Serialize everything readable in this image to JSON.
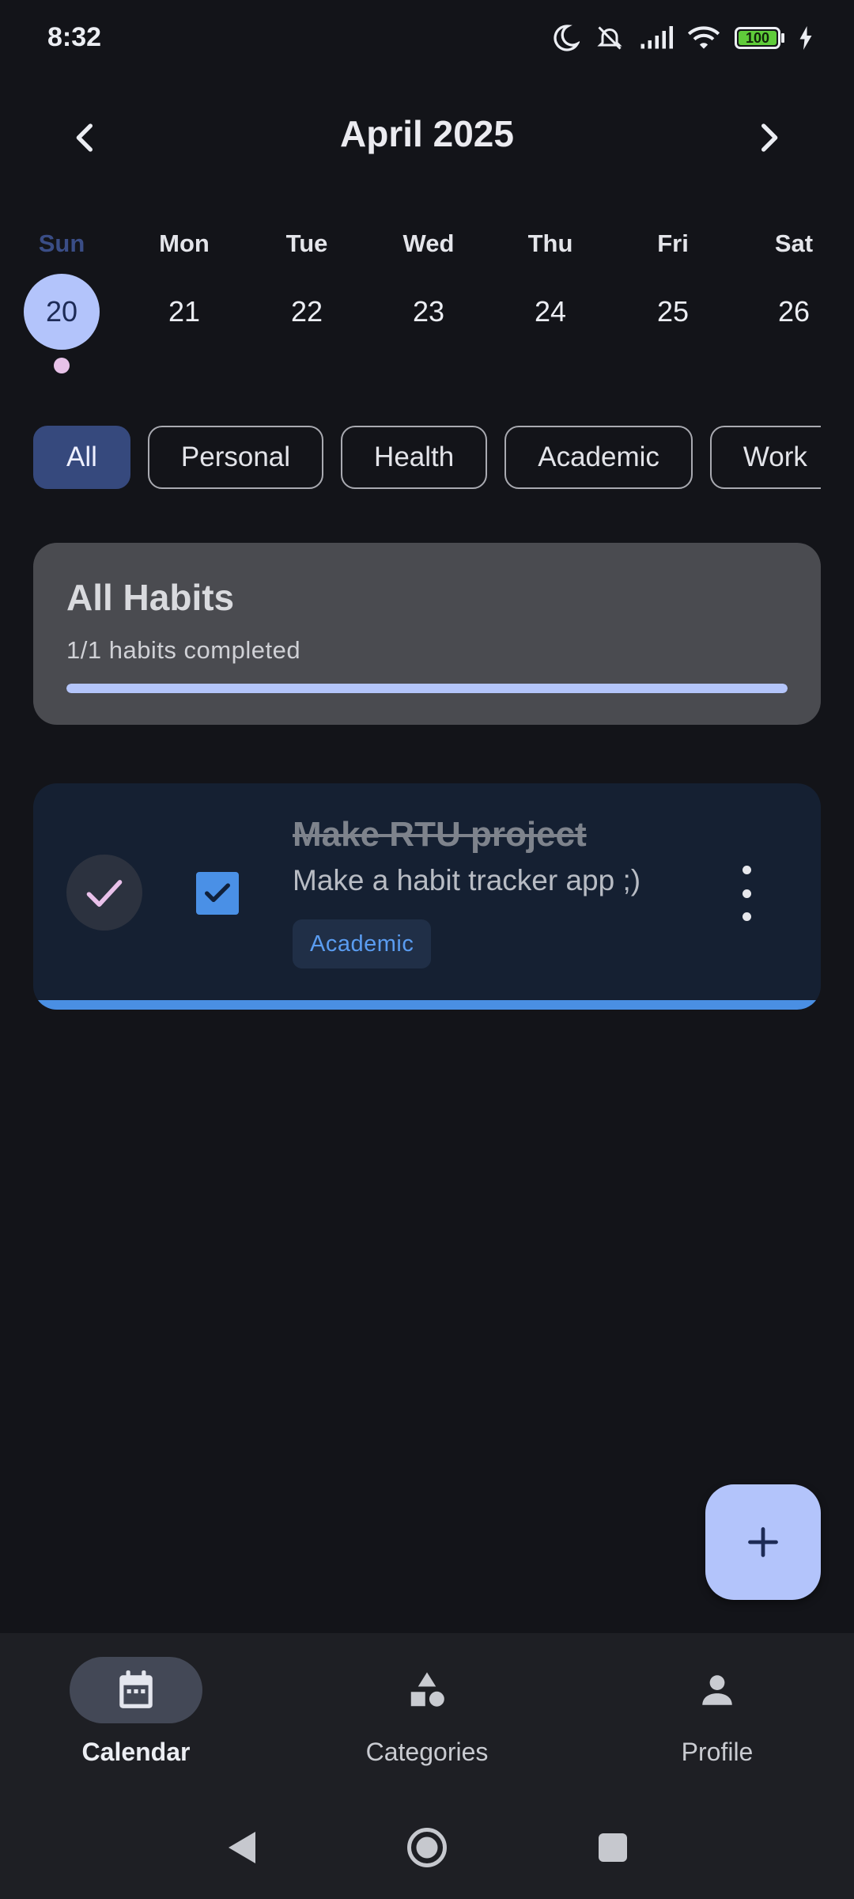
{
  "status_bar": {
    "time": "8:32",
    "battery": "100"
  },
  "header": {
    "month": "April 2025",
    "prev_icon": "chevron-left-icon",
    "next_icon": "chevron-right-icon"
  },
  "week": {
    "days": [
      {
        "name": "Sun",
        "num": "20",
        "selected": true,
        "has_dot": true
      },
      {
        "name": "Mon",
        "num": "21",
        "selected": false
      },
      {
        "name": "Tue",
        "num": "22",
        "selected": false
      },
      {
        "name": "Wed",
        "num": "23",
        "selected": false
      },
      {
        "name": "Thu",
        "num": "24",
        "selected": false
      },
      {
        "name": "Fri",
        "num": "25",
        "selected": false
      },
      {
        "name": "Sat",
        "num": "26",
        "selected": false
      }
    ]
  },
  "filters": {
    "chips": [
      "All",
      "Personal",
      "Health",
      "Academic",
      "Work"
    ],
    "active_index": 0
  },
  "summary": {
    "title": "All Habits",
    "subtitle": "1/1 habits completed",
    "progress_fraction": 1.0
  },
  "habits": [
    {
      "title": "Make RTU project",
      "description": "Make a habit tracker app ;)",
      "tag": "Academic",
      "completed": true,
      "accent_color": "#4a8fe3"
    }
  ],
  "fab": {
    "icon": "plus-icon"
  },
  "bottom_nav": {
    "items": [
      {
        "label": "Calendar",
        "icon": "calendar-icon",
        "active": true
      },
      {
        "label": "Categories",
        "icon": "categories-icon",
        "active": false
      },
      {
        "label": "Profile",
        "icon": "profile-icon",
        "active": false
      }
    ]
  },
  "colors": {
    "background": "#131419",
    "accent": "#b3c4fb",
    "chip_active": "#36497d",
    "habit_card": "#152032",
    "tag_text": "#5a9cf0"
  }
}
